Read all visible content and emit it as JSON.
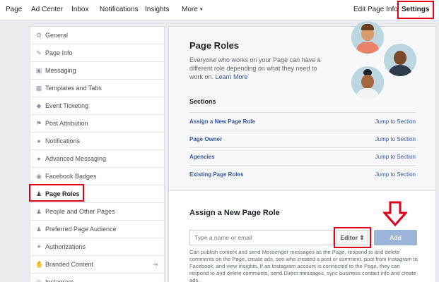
{
  "topnav": {
    "items": [
      "Page",
      "Ad Center",
      "Inbox",
      "Notifications",
      "Insights",
      "More"
    ],
    "edit_page_info": "Edit Page Info",
    "settings": "Settings"
  },
  "sidebar": {
    "items": [
      {
        "label": "General",
        "icon": "gear-icon"
      },
      {
        "label": "Page Info",
        "icon": "pencil-icon"
      },
      {
        "label": "Messaging",
        "icon": "chat-bubble-icon"
      },
      {
        "label": "Templates and Tabs",
        "icon": "grid-icon"
      },
      {
        "label": "Event Ticketing",
        "icon": "ticket-icon"
      },
      {
        "label": "Post Attribution",
        "icon": "flag-icon"
      },
      {
        "label": "Notifications",
        "icon": "globe-icon"
      },
      {
        "label": "Advanced Messaging",
        "icon": "messenger-icon"
      },
      {
        "label": "Facebook Badges",
        "icon": "badge-icon"
      },
      {
        "label": "Page Roles",
        "icon": "person-icon"
      },
      {
        "label": "People and Other Pages",
        "icon": "people-icon"
      },
      {
        "label": "Preferred Page Audience",
        "icon": "audience-icon"
      },
      {
        "label": "Authorizations",
        "icon": "wrench-icon"
      },
      {
        "label": "Branded Content",
        "icon": "handshake-icon"
      },
      {
        "label": "Instagram",
        "icon": "instagram-icon"
      }
    ],
    "active_index": 9
  },
  "main": {
    "title": "Page Roles",
    "description": "Everyone who works on your Page can have a different role depending on what they need to work on.",
    "learn_more": "Learn More",
    "sections_heading": "Sections",
    "sections": [
      {
        "name": "Assign a New Page Role",
        "jump": "Jump to Section"
      },
      {
        "name": "Page Owner",
        "jump": "Jump to Section"
      },
      {
        "name": "Agencies",
        "jump": "Jump to Section"
      },
      {
        "name": "Existing Page Roles",
        "jump": "Jump to Section"
      }
    ],
    "assign": {
      "heading": "Assign a New Page Role",
      "input_placeholder": "Type a name or email",
      "role_select": "Editor",
      "add_button": "Add",
      "help_text": "Can publish content and send Messenger messages as the Page, respond to and delete comments on the Page, create ads, see who created a post or comment, post from Instagram to Facebook, and view insights. If an Instagram account is connected to the Page, they can respond to and delete comments, send Direct messages, sync business contact info and create ads."
    }
  },
  "colors": {
    "highlight_red": "#e0001a",
    "link_blue": "#365899",
    "add_button_disabled": "#9cb4d8"
  }
}
